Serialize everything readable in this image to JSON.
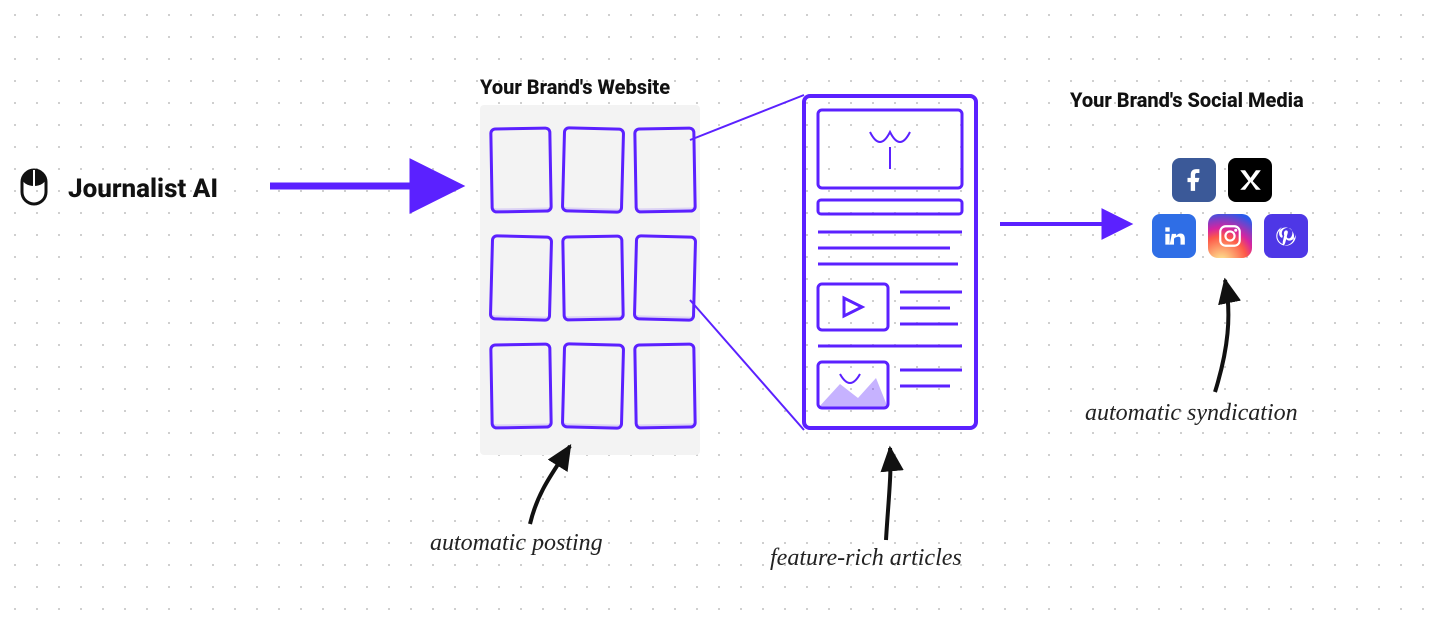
{
  "brand": {
    "name": "Journalist AI"
  },
  "headings": {
    "website": "Your Brand's Website",
    "social": "Your Brand's Social Media"
  },
  "captions": {
    "posting": "automatic posting",
    "articles": "feature-rich articles",
    "syndication": "automatic syndication"
  },
  "social_icons": [
    "facebook",
    "x",
    "linkedin",
    "instagram",
    "pinterest"
  ],
  "colors": {
    "accent": "#5B21FF",
    "ink": "#111111"
  }
}
